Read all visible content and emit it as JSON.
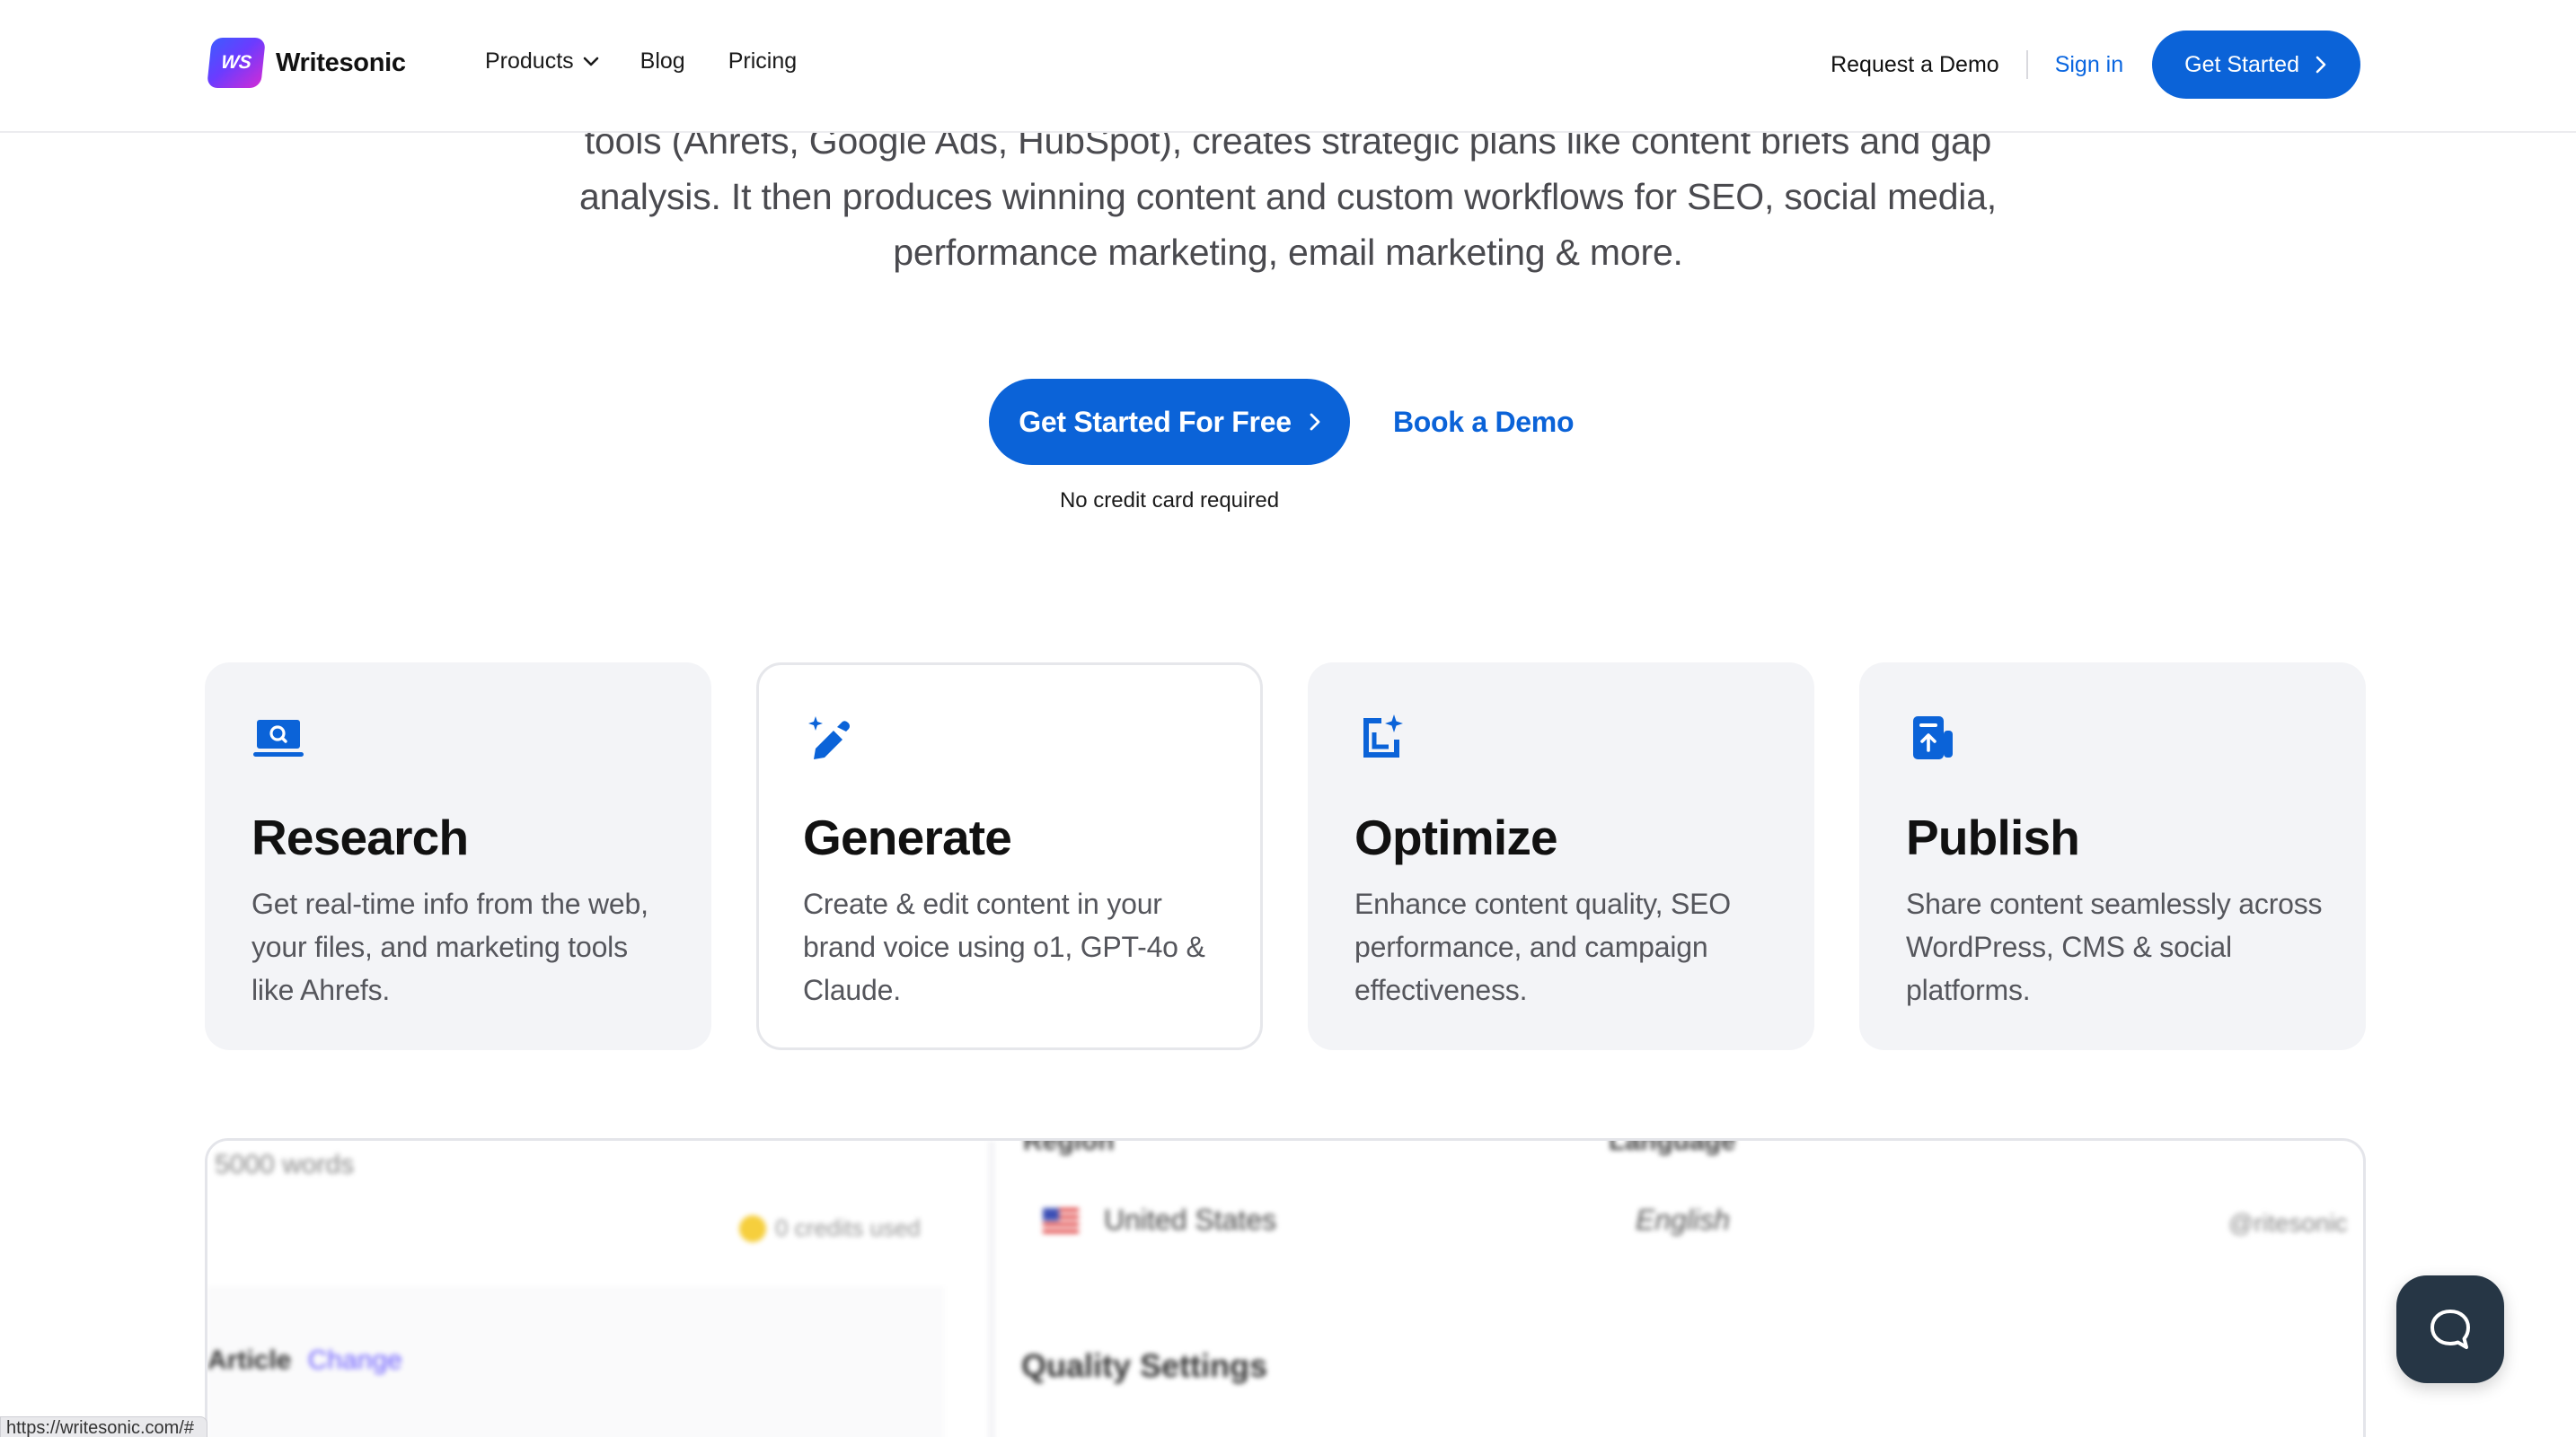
{
  "nav": {
    "logo_mark": "WS",
    "logo_text": "Writesonic",
    "products": "Products",
    "blog": "Blog",
    "pricing": "Pricing",
    "request_demo": "Request a Demo",
    "sign_in": "Sign in",
    "get_started": "Get Started"
  },
  "hero": {
    "line1": "tools (Ahrefs, Google Ads, HubSpot), creates strategic plans like content briefs and gap",
    "line2": "analysis. It then produces winning content and custom workflows for SEO, social media,",
    "line3": "performance marketing, email marketing & more.",
    "cta_primary": "Get Started For Free",
    "cta_secondary": "Book a Demo",
    "note": "No credit card required"
  },
  "cards": [
    {
      "icon": "laptop-search-icon",
      "title": "Research",
      "desc": "Get real-time info from the web, your files, and marketing tools like Ahrefs."
    },
    {
      "icon": "magic-pen-icon",
      "title": "Generate",
      "desc": "Create & edit content in your brand voice using o1, GPT-4o & Claude."
    },
    {
      "icon": "document-sparkle-icon",
      "title": "Optimize",
      "desc": "Enhance content quality, SEO performance, and campaign effectiveness."
    },
    {
      "icon": "publish-document-icon",
      "title": "Publish",
      "desc": "Share content seamlessly across WordPress, CMS & social platforms."
    }
  ],
  "preview": {
    "words": "5000 words",
    "credits": "0 credits used",
    "article": "Article",
    "change": "Change",
    "region": "Region",
    "language": "Language",
    "country": "United States",
    "lang_value": "English",
    "quality": "Quality Settings",
    "far_right": "@ritesonic"
  },
  "status_bar": {
    "url": "https://writesonic.com/#"
  },
  "colors": {
    "primary": "#0b63d8",
    "card_bg": "#f3f4f7",
    "chat_bg": "#263645"
  }
}
